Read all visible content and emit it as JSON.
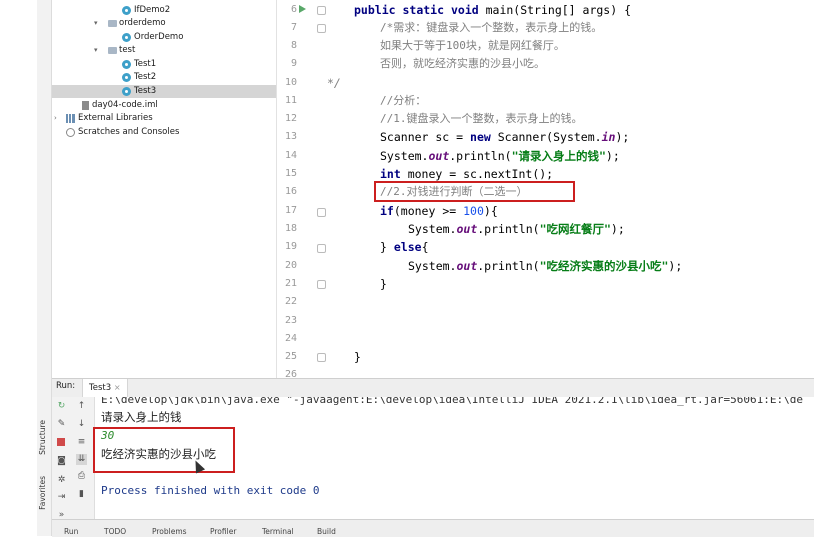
{
  "project_tree": {
    "items": [
      {
        "label": "IfDemo2",
        "kind": "class"
      },
      {
        "label": "orderdemo",
        "kind": "folder"
      },
      {
        "label": "OrderDemo",
        "kind": "class"
      },
      {
        "label": "test",
        "kind": "folder"
      },
      {
        "label": "Test1",
        "kind": "class"
      },
      {
        "label": "Test2",
        "kind": "class"
      },
      {
        "label": "Test3",
        "kind": "class",
        "selected": true
      },
      {
        "label": "day04-code.iml",
        "kind": "iml"
      },
      {
        "label": "External Libraries",
        "kind": "lib"
      },
      {
        "label": "Scratches and Consoles",
        "kind": "scratch"
      }
    ]
  },
  "editor": {
    "line_numbers": [
      "6",
      "7",
      "8",
      "9",
      "10",
      "11",
      "12",
      "13",
      "14",
      "15",
      "16",
      "17",
      "18",
      "19",
      "20",
      "21",
      "22",
      "23",
      "24",
      "25",
      "26"
    ],
    "code": {
      "l6_kw1": "public",
      "l6_kw2": "static",
      "l6_kw3": "void",
      "l6_rest": " main(String[] args) {",
      "l7": "/*需求：键盘录入一个整数，表示身上的钱。",
      "l8": "如果大于等于100块，就是网红餐厅。",
      "l9": "否则，就吃经济实惠的沙县小吃。",
      "l10": "*/",
      "l11": "//分析：",
      "l12": "//1.键盘录入一个整数，表示身上的钱。",
      "l13_a": "Scanner sc = ",
      "l13_kw": "new",
      "l13_b": " Scanner(System.",
      "l13_fld": "in",
      "l13_c": ");",
      "l14_a": "System.",
      "l14_fld": "out",
      "l14_b": ".println(",
      "l14_str": "\"请录入身上的钱\"",
      "l14_c": ");",
      "l15_kw": "int",
      "l15_rest": " money = sc.nextInt();",
      "l16": "//2.对钱进行判断（二选一）",
      "l17_kw": "if",
      "l17_a": "(money >= ",
      "l17_num": "100",
      "l17_b": "){",
      "l18_a": "System.",
      "l18_fld": "out",
      "l18_b": ".println(",
      "l18_str": "\"吃网红餐厅\"",
      "l18_c": ");",
      "l19_a": "} ",
      "l19_kw": "else",
      "l19_b": "{",
      "l20_a": "System.",
      "l20_fld": "out",
      "l20_b": ".println(",
      "l20_str": "\"吃经济实惠的沙县小吃\"",
      "l20_c": ");",
      "l21": "}",
      "l25": "}"
    }
  },
  "run_window": {
    "label": "Run:",
    "tab": "Test3",
    "console_lines": {
      "cmd": "E:\\develop\\jdk\\bin\\java.exe \"-javaagent:E:\\develop\\idea\\IntelliJ IDEA 2021.2.1\\lib\\idea_rt.jar=56061:E:\\de",
      "prompt": "请录入身上的钱",
      "input": "30",
      "output": "吃经济实惠的沙县小吃",
      "exit": "Process finished with exit code 0"
    }
  },
  "side_tabs": {
    "structure": "Structure",
    "favorites": "Favorites"
  },
  "bottom_bar": [
    "Run",
    "TODO",
    "Problems",
    "Profiler",
    "Terminal",
    "Build"
  ],
  "colors": {
    "highlight_border": "#cc1f1f",
    "keyword": "#000080",
    "string": "#067d17",
    "comment": "#808080"
  }
}
